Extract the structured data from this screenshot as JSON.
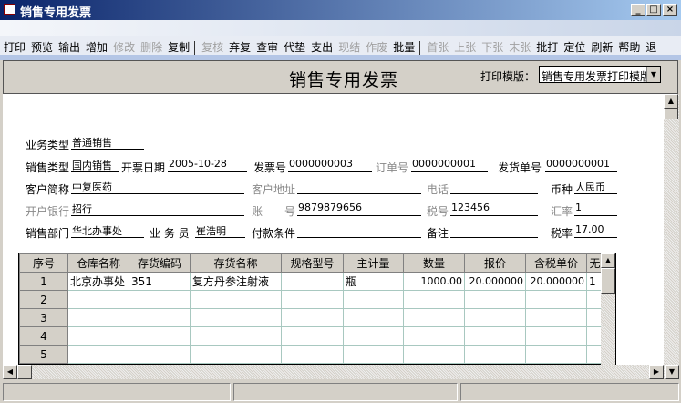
{
  "window": {
    "title": "销售专用发票"
  },
  "toolbar": [
    {
      "label": "打印",
      "enabled": true
    },
    {
      "label": "预览",
      "enabled": true
    },
    {
      "label": "输出",
      "enabled": true
    },
    {
      "label": "增加",
      "enabled": true
    },
    {
      "label": "修改",
      "enabled": false
    },
    {
      "label": "删除",
      "enabled": false
    },
    {
      "label": "复制",
      "enabled": true
    },
    {
      "sep": true
    },
    {
      "label": "复核",
      "enabled": false
    },
    {
      "label": "弃复",
      "enabled": true
    },
    {
      "label": "查审",
      "enabled": true
    },
    {
      "label": "代垫",
      "enabled": true
    },
    {
      "label": "支出",
      "enabled": true
    },
    {
      "label": "现结",
      "enabled": false
    },
    {
      "label": "作废",
      "enabled": false
    },
    {
      "label": "批量",
      "enabled": true
    },
    {
      "sep": true
    },
    {
      "label": "首张",
      "enabled": false
    },
    {
      "label": "上张",
      "enabled": false
    },
    {
      "label": "下张",
      "enabled": false
    },
    {
      "label": "末张",
      "enabled": false
    },
    {
      "label": "批打",
      "enabled": true
    },
    {
      "label": "定位",
      "enabled": true
    },
    {
      "label": "刷新",
      "enabled": true
    },
    {
      "label": "帮助",
      "enabled": true
    },
    {
      "label": "退",
      "enabled": true
    }
  ],
  "header": {
    "title": "销售专用发票",
    "template_label": "打印模版：",
    "template_value": "销售专用发票打印模版"
  },
  "form": {
    "biz_type": {
      "label": "业务类型",
      "value": "普通销售"
    },
    "sale_type": {
      "label": "销售类型",
      "value": "国内销售"
    },
    "invoice_date": {
      "label": "开票日期",
      "value": "2005-10-28"
    },
    "invoice_no": {
      "label": "发票号",
      "value": "0000000003"
    },
    "order_no": {
      "label": "订单号",
      "value": "0000000001"
    },
    "delivery_no": {
      "label": "发货单号",
      "value": "0000000001"
    },
    "customer": {
      "label": "客户简称",
      "value": "中复医药"
    },
    "address": {
      "label": "客户地址",
      "value": ""
    },
    "phone": {
      "label": "电话",
      "value": ""
    },
    "currency": {
      "label": "币种",
      "value": "人民币"
    },
    "bank": {
      "label": "开户银行",
      "value": "招行"
    },
    "account": {
      "label": "账　　号",
      "value": "9879879656"
    },
    "tax_id": {
      "label": "税号",
      "value": "123456"
    },
    "exchange_rate": {
      "label": "汇率",
      "value": "1"
    },
    "dept": {
      "label": "销售部门",
      "value": "华北办事处"
    },
    "salesman": {
      "label": "业 务 员",
      "value": "崔浩明"
    },
    "payment_terms": {
      "label": "付款条件",
      "value": ""
    },
    "remark": {
      "label": "备注",
      "value": ""
    },
    "tax_rate": {
      "label": "税率",
      "value": "17.00"
    }
  },
  "grid": {
    "columns": [
      "序号",
      "仓库名称",
      "存货编码",
      "存货名称",
      "规格型号",
      "主计量",
      "数量",
      "报价",
      "含税单价",
      "无"
    ],
    "rows": [
      [
        "1",
        "北京办事处",
        "351",
        "复方丹参注射液",
        "",
        "瓶",
        "1000.00",
        "20.000000",
        "20.000000",
        "1"
      ],
      [
        "2",
        "",
        "",
        "",
        "",
        "",
        "",
        "",
        "",
        ""
      ],
      [
        "3",
        "",
        "",
        "",
        "",
        "",
        "",
        "",
        "",
        ""
      ],
      [
        "4",
        "",
        "",
        "",
        "",
        "",
        "",
        "",
        "",
        ""
      ],
      [
        "5",
        "",
        "",
        "",
        "",
        "",
        "",
        "",
        "",
        ""
      ]
    ]
  }
}
